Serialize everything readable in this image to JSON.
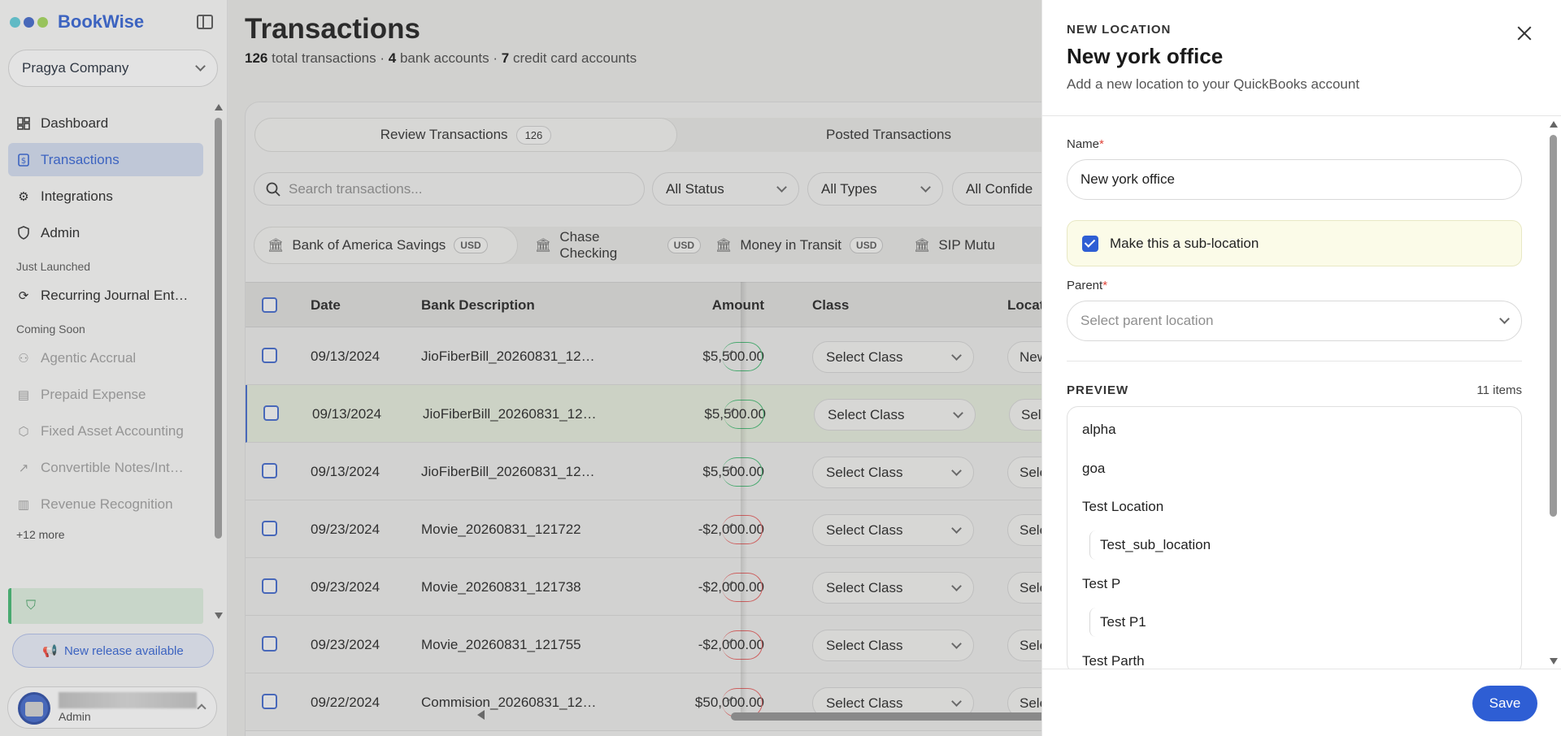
{
  "app": {
    "brand": "BookWise",
    "company": "Pragya Company",
    "brand_dot_colors": [
      "#5cc8d6",
      "#3e64c7",
      "#9fd356"
    ]
  },
  "sidebar": {
    "nav": [
      {
        "label": "Dashboard",
        "icon": "dashboard-icon"
      },
      {
        "label": "Transactions",
        "icon": "transactions-icon",
        "active": true
      },
      {
        "label": "Integrations",
        "icon": "gear-icon"
      },
      {
        "label": "Admin",
        "icon": "shield-icon"
      }
    ],
    "just_launched_label": "Just Launched",
    "just_launched": [
      {
        "label": "Recurring Journal Ent…",
        "icon": "refresh-icon"
      }
    ],
    "coming_soon_label": "Coming Soon",
    "coming_soon": [
      {
        "label": "Agentic Accrual",
        "icon": "robot-icon"
      },
      {
        "label": "Prepaid Expense",
        "icon": "calendar-icon"
      },
      {
        "label": "Fixed Asset Accounting",
        "icon": "box-icon"
      },
      {
        "label": "Convertible Notes/Int…",
        "icon": "trend-icon"
      },
      {
        "label": "Revenue Recognition",
        "icon": "chart-icon"
      }
    ],
    "more_label": "+12 more",
    "release_label": "New release available",
    "user_role": "Admin"
  },
  "main": {
    "title": "Transactions",
    "summary": {
      "total_count": "126",
      "total_label": "total transactions",
      "bank_count": "4",
      "bank_label": "bank accounts",
      "card_count": "7",
      "card_label": "credit card accounts",
      "separator": "·"
    },
    "tabs": [
      {
        "label": "Review Transactions",
        "badge": "126"
      },
      {
        "label": "Posted Transactions"
      }
    ],
    "search_placeholder": "Search transactions...",
    "filters": [
      "All Status",
      "All Types",
      "All Confide"
    ],
    "accounts": [
      {
        "label": "Bank of America Savings",
        "currency": "USD"
      },
      {
        "label": "Chase Checking",
        "currency": "USD"
      },
      {
        "label": "Money in Transit",
        "currency": "USD"
      },
      {
        "label": "SIP Mutu",
        "currency": ""
      }
    ],
    "columns": {
      "date": "Date",
      "description": "Bank Description",
      "amount": "Amount",
      "class": "Class",
      "location": "Locatio"
    },
    "rows": [
      {
        "date": "09/13/2024",
        "description": "JioFiberBill_20260831_12…",
        "amount": "$5,500.00",
        "status": "green",
        "class": "Select Class",
        "location": "New y"
      },
      {
        "date": "09/13/2024",
        "description": "JioFiberBill_20260831_12…",
        "amount": "$5,500.00",
        "status": "green",
        "class": "Select Class",
        "location": "Select"
      },
      {
        "date": "09/13/2024",
        "description": "JioFiberBill_20260831_12…",
        "amount": "$5,500.00",
        "status": "green",
        "class": "Select Class",
        "location": "Select"
      },
      {
        "date": "09/23/2024",
        "description": "Movie_20260831_121722",
        "amount": "-$2,000.00",
        "status": "red",
        "class": "Select Class",
        "location": "Select"
      },
      {
        "date": "09/23/2024",
        "description": "Movie_20260831_121738",
        "amount": "-$2,000.00",
        "status": "red",
        "class": "Select Class",
        "location": "Select"
      },
      {
        "date": "09/23/2024",
        "description": "Movie_20260831_121755",
        "amount": "-$2,000.00",
        "status": "red",
        "class": "Select Class",
        "location": "Select"
      },
      {
        "date": "09/22/2024",
        "description": "Commision_20260831_12…",
        "amount": "$50,000.00",
        "status": "red",
        "class": "Select Class",
        "location": "Select"
      }
    ]
  },
  "drawer": {
    "eyebrow": "NEW LOCATION",
    "title": "New york office",
    "subtitle": "Add a new location to your QuickBooks account",
    "name_label": "Name",
    "required_mark": "*",
    "name_value": "New york office",
    "sub_location_label": "Make this a sub-location",
    "sub_location_checked": true,
    "parent_label": "Parent",
    "parent_placeholder": "Select parent location",
    "preview_label": "PREVIEW",
    "preview_count": "11 items",
    "preview_items": [
      {
        "label": "alpha",
        "level": 0
      },
      {
        "label": "goa",
        "level": 0
      },
      {
        "label": "Test Location",
        "level": 0
      },
      {
        "label": "Test_sub_location",
        "level": 1
      },
      {
        "label": "Test P",
        "level": 0
      },
      {
        "label": "Test P1",
        "level": 1
      },
      {
        "label": "Test Parth",
        "level": 0
      }
    ],
    "save_label": "Save",
    "accent": "#2e5ed4"
  }
}
